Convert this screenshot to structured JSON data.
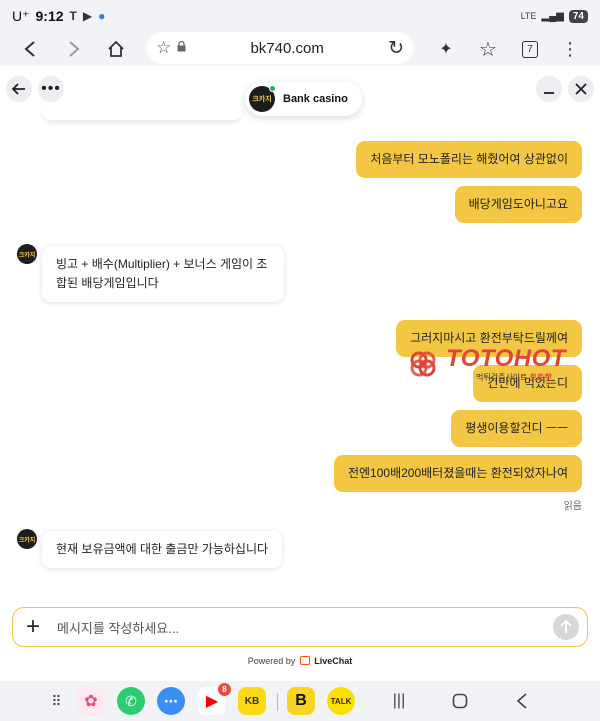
{
  "status_bar": {
    "carrier": "U⁺",
    "time": "9:12",
    "network": "LTE",
    "battery": "74"
  },
  "browser": {
    "url": "bk740.com",
    "tab_count": "7"
  },
  "chat": {
    "agent_name": "Bank casino",
    "agent_logo_text": "크카지",
    "messages": [
      {
        "from": "user",
        "text": "처음부터 모노폴리는 해줬어여 상관없이"
      },
      {
        "from": "user",
        "text": "배당게임도아니고요"
      },
      {
        "from": "agent",
        "text": "빙고 + 배수(Multiplier) + 보너스 게임이 조합된 배당게임입니다"
      },
      {
        "from": "user",
        "text": "그러지마시고 환전부탁드릴께여"
      },
      {
        "from": "user",
        "text": "긴만에 먹었는디"
      },
      {
        "from": "user",
        "text": "평생이용할건디 ㅡㅡ"
      },
      {
        "from": "user",
        "text": "전엔100배200배터졌을때는 환전되었자나여"
      },
      {
        "from": "agent",
        "text": "현재 보유금액에 대한 출금만 가능하십니다"
      }
    ],
    "read_receipt": "읽음",
    "input_placeholder": "메시지를 작성하세요...",
    "powered_by": "Powered by",
    "brand": "LiveChat"
  },
  "watermark": {
    "text_a": "TOTO",
    "text_b": "HOT",
    "sub": "먹튀검증사이트",
    "sub_red": "토토핫"
  },
  "nav": {
    "youtube_badge": "8",
    "kb_label": "KB",
    "b_label": "B",
    "talk_label": "TALK"
  },
  "colors": {
    "user_bubble": "#f3c744",
    "watermark_red": "#e0453a",
    "online_dot": "#27ae60"
  }
}
